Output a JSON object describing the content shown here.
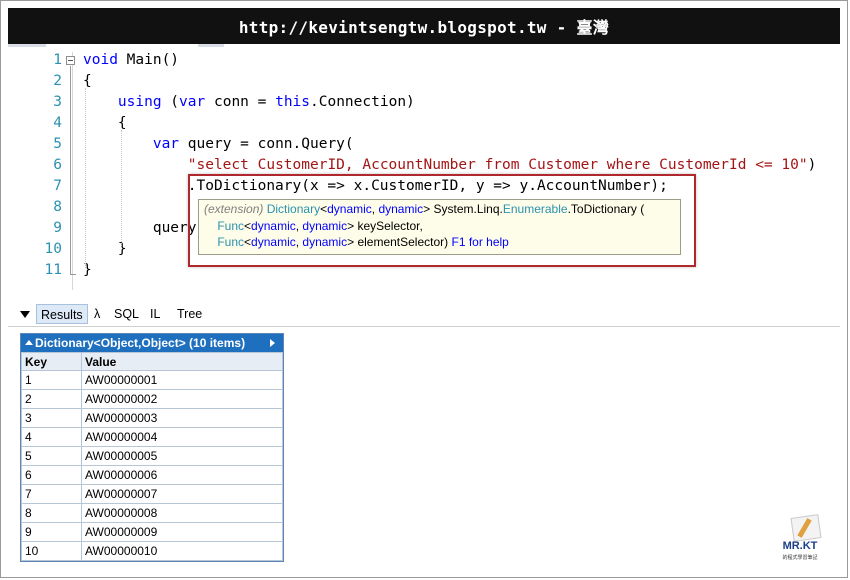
{
  "banner": {
    "text": "http://kevintsengtw.blogspot.tw - 臺灣"
  },
  "editor": {
    "lines": [
      {
        "n": "1",
        "parts": [
          {
            "t": "void",
            "c": "kw"
          },
          {
            "t": " Main()",
            "c": ""
          }
        ]
      },
      {
        "n": "2",
        "parts": [
          {
            "t": "{",
            "c": ""
          }
        ]
      },
      {
        "n": "3",
        "parts": [
          {
            "t": "    ",
            "c": ""
          },
          {
            "t": "using",
            "c": "kw"
          },
          {
            "t": " (",
            "c": ""
          },
          {
            "t": "var",
            "c": "kw"
          },
          {
            "t": " conn = ",
            "c": ""
          },
          {
            "t": "this",
            "c": "kw"
          },
          {
            "t": ".Connection)",
            "c": ""
          }
        ]
      },
      {
        "n": "4",
        "parts": [
          {
            "t": "    {",
            "c": ""
          }
        ]
      },
      {
        "n": "5",
        "parts": [
          {
            "t": "        ",
            "c": ""
          },
          {
            "t": "var",
            "c": "kw"
          },
          {
            "t": " query = conn.Query(",
            "c": ""
          }
        ]
      },
      {
        "n": "6",
        "parts": [
          {
            "t": "            ",
            "c": ""
          },
          {
            "t": "\"select CustomerID, AccountNumber from Customer where CustomerId <= 10\"",
            "c": "str"
          },
          {
            "t": ")",
            "c": ""
          }
        ]
      },
      {
        "n": "7",
        "parts": [
          {
            "t": "            .ToDictionary(x => x.CustomerID, y => y.AccountNumber);",
            "c": ""
          }
        ]
      },
      {
        "n": "8",
        "parts": [
          {
            "t": "",
            "c": ""
          }
        ]
      },
      {
        "n": "9",
        "parts": [
          {
            "t": "        query",
            "c": ""
          }
        ]
      },
      {
        "n": "10",
        "parts": [
          {
            "t": "    }",
            "c": ""
          }
        ]
      },
      {
        "n": "11",
        "parts": [
          {
            "t": "}",
            "c": ""
          }
        ]
      }
    ]
  },
  "tooltip": {
    "line1": {
      "ext": "(extension)",
      "type": "Dictionary",
      "lt": "<",
      "dyn1": "dynamic",
      "comma": ", ",
      "dyn2": "dynamic",
      "gt": "> ",
      "ns": "System.Linq.",
      "cls": "Enumerable",
      "method": ".ToDictionary ("
    },
    "line2": {
      "type": "Func",
      "lt": "<",
      "dyn1": "dynamic",
      "comma": ", ",
      "dyn2": "dynamic",
      "gt": "> ",
      "param": "keySelector,"
    },
    "line3": {
      "type": "Func",
      "lt": "<",
      "dyn1": "dynamic",
      "comma": ", ",
      "dyn2": "dynamic",
      "gt": "> ",
      "param": "elementSelector) ",
      "help": "F1 for help"
    }
  },
  "result_tabs": {
    "items": [
      "Results",
      "λ",
      "SQL",
      "IL",
      "Tree"
    ],
    "active": "Results"
  },
  "results": {
    "title": "Dictionary<Object,Object> (10 items)",
    "columns": [
      "Key",
      "Value"
    ],
    "rows": [
      [
        "1",
        "AW00000001"
      ],
      [
        "2",
        "AW00000002"
      ],
      [
        "3",
        "AW00000003"
      ],
      [
        "4",
        "AW00000004"
      ],
      [
        "5",
        "AW00000005"
      ],
      [
        "6",
        "AW00000006"
      ],
      [
        "7",
        "AW00000007"
      ],
      [
        "8",
        "AW00000008"
      ],
      [
        "9",
        "AW00000009"
      ],
      [
        "10",
        "AW00000010"
      ]
    ]
  },
  "logo": {
    "name": "MR.KT",
    "sub": "的程式學習筆記"
  },
  "colors": {
    "keyword": "#0000ff",
    "string": "#a31515",
    "line_number": "#2b91af",
    "results_header": "#1f6fbf",
    "highlight_border": "#b0282e"
  }
}
